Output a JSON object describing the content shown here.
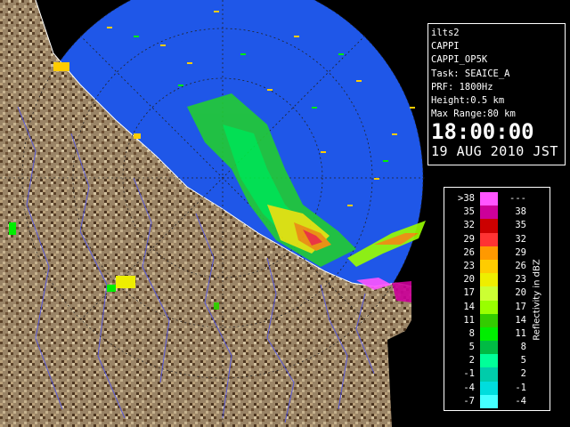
{
  "info": {
    "station": "ilts2",
    "product": "CAPPI",
    "product_code": "CAPPI_OP5K",
    "task": "Task: SEAICE_A",
    "prf": "PRF: 1800Hz",
    "height": "Height:0.5 km",
    "max_range": "Max Range:80 km",
    "time": "18:00:00",
    "date": "19 AUG 2010 JST"
  },
  "legend": {
    "title": "Reflectivity in dBZ",
    "rows": [
      {
        "low": ">38",
        "high": "---",
        "color": "#ff55ff"
      },
      {
        "low": "35",
        "high": "38",
        "color": "#cc0099"
      },
      {
        "low": "32",
        "high": "35",
        "color": "#cc0000"
      },
      {
        "low": "29",
        "high": "32",
        "color": "#ff3333"
      },
      {
        "low": "26",
        "high": "29",
        "color": "#ff9900"
      },
      {
        "low": "23",
        "high": "26",
        "color": "#ffcc00"
      },
      {
        "low": "20",
        "high": "23",
        "color": "#eeee00"
      },
      {
        "low": "17",
        "high": "20",
        "color": "#ccff33"
      },
      {
        "low": "14",
        "high": "17",
        "color": "#99ff00"
      },
      {
        "low": "11",
        "high": "14",
        "color": "#33cc00"
      },
      {
        "low": "8",
        "high": "11",
        "color": "#00ee00"
      },
      {
        "low": "5",
        "high": "8",
        "color": "#00bb44"
      },
      {
        "low": "2",
        "high": "5",
        "color": "#00ff99"
      },
      {
        "low": "-1",
        "high": "2",
        "color": "#00ccaa"
      },
      {
        "low": "-4",
        "high": "-1",
        "color": "#00dddd"
      },
      {
        "low": "-7",
        "high": "-4",
        "color": "#44ffff"
      }
    ]
  },
  "colors": {
    "ocean": "#1f57e8",
    "land": "#9a8466",
    "rivers": "#5a5ad8"
  }
}
